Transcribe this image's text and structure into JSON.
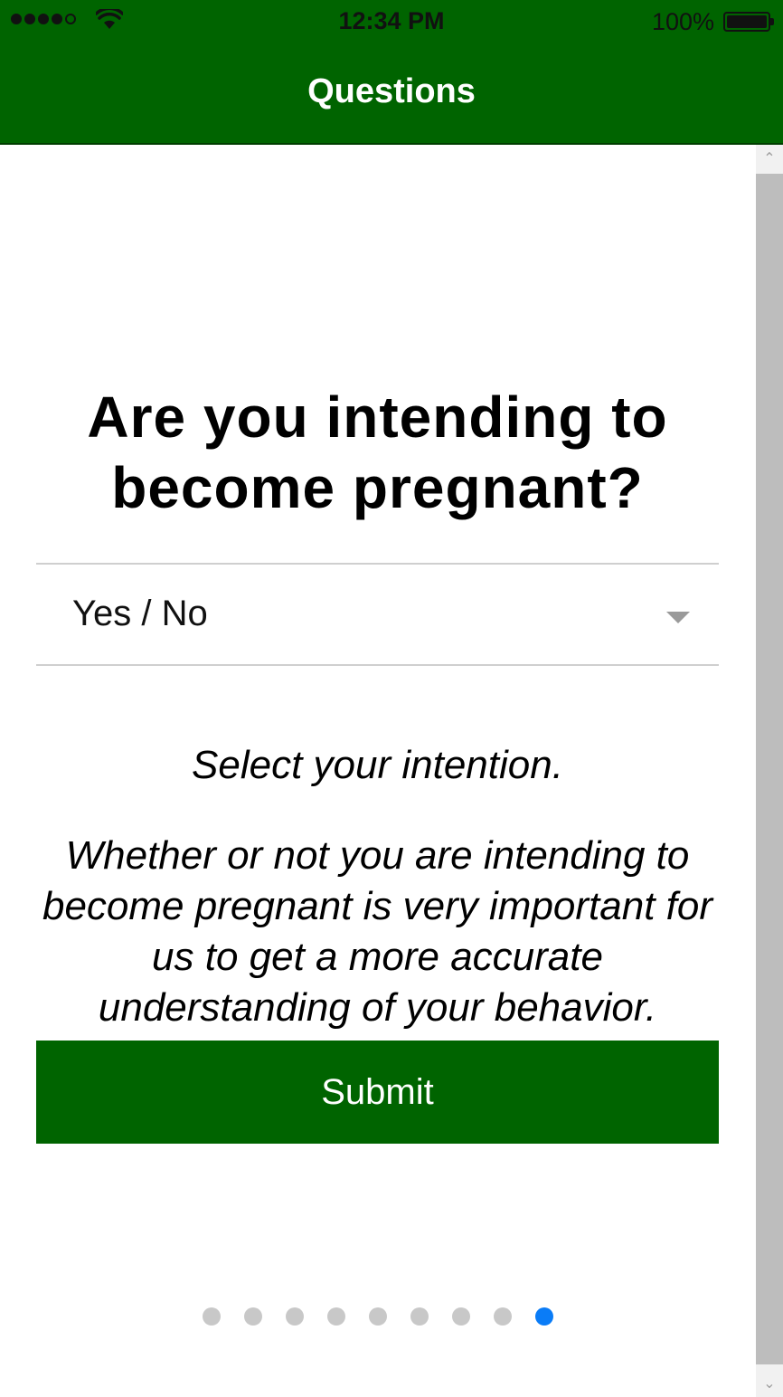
{
  "status_bar": {
    "time": "12:34 PM",
    "battery_percent": "100%",
    "signal_icon": "cellular-signal-icon",
    "wifi_icon": "wifi-icon",
    "battery_icon": "battery-icon",
    "signal_bars_filled": 4,
    "signal_bars_total": 5,
    "battery_level": 1.0
  },
  "header": {
    "title": "Questions",
    "background_color": "#006400"
  },
  "question": {
    "title": "Are you intending to become pregnant?",
    "select": {
      "value": "Yes / No",
      "caret_icon": "chevron-down-icon"
    },
    "hint": "Select your intention.",
    "description": "Whether or not you are intending to become pregnant is very important for us to get a more accurate understanding of your behavior."
  },
  "submit": {
    "label": "Submit",
    "color": "#006400"
  },
  "pager": {
    "total": 9,
    "current": 9,
    "active_color": "#0a7cf7",
    "inactive_color": "#c8c8c8"
  },
  "scrollbar": {
    "up_icon": "scroll-up-arrow-icon",
    "down_icon": "scroll-down-arrow-icon"
  }
}
